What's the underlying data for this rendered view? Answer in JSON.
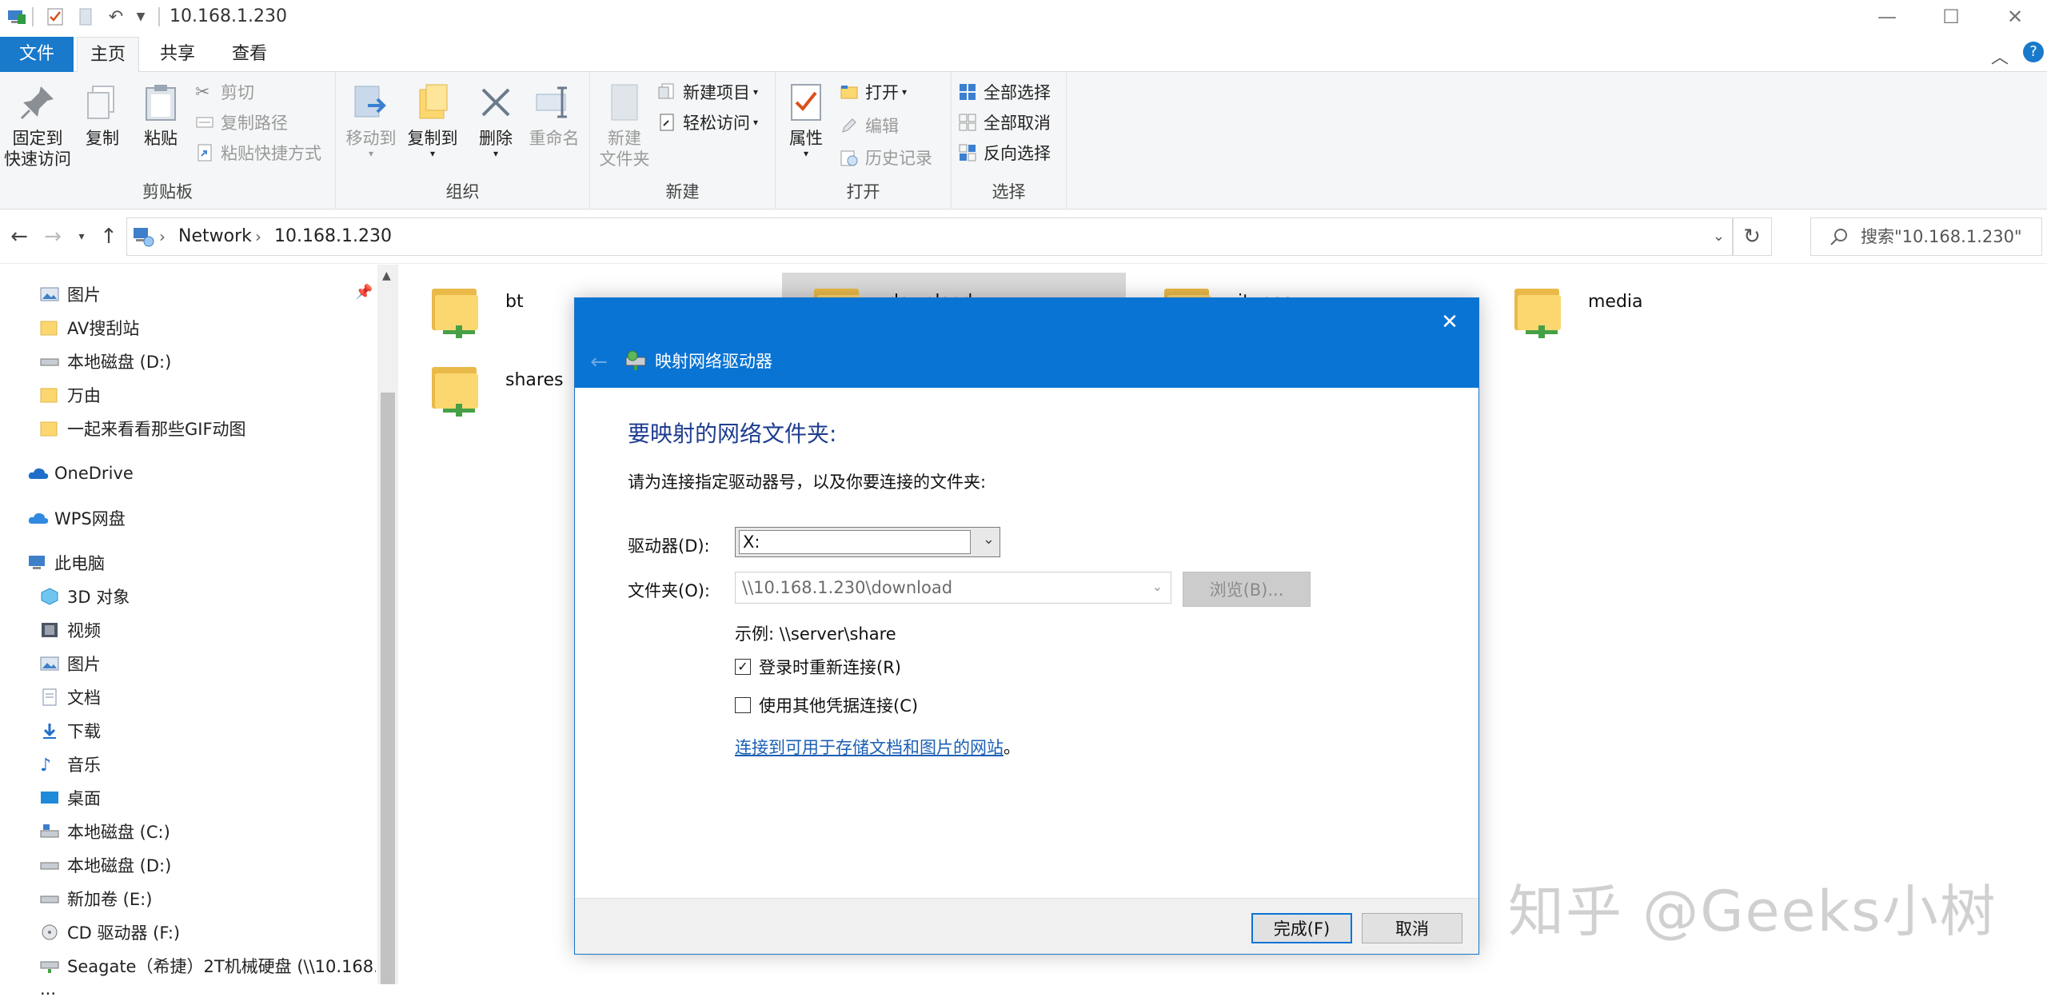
{
  "window": {
    "title": "10.168.1.230"
  },
  "ribbon_tabs": {
    "file": "文件",
    "home": "主页",
    "share": "共享",
    "view": "查看"
  },
  "ribbon": {
    "clipboard": {
      "label": "剪贴板",
      "pin_line1": "固定到",
      "pin_line2": "快速访问",
      "copy": "复制",
      "paste": "粘贴",
      "cut": "剪切",
      "copy_path": "复制路径",
      "paste_shortcut": "粘贴快捷方式"
    },
    "organize": {
      "label": "组织",
      "move_to": "移动到",
      "copy_to": "复制到",
      "delete": "删除",
      "rename": "重命名"
    },
    "new": {
      "label": "新建",
      "new_folder_line1": "新建",
      "new_folder_line2": "文件夹",
      "new_item": "新建项目",
      "easy_access": "轻松访问"
    },
    "open": {
      "label": "打开",
      "properties": "属性",
      "open": "打开",
      "edit": "编辑",
      "history": "历史记录"
    },
    "select": {
      "label": "选择",
      "select_all": "全部选择",
      "select_none": "全部取消",
      "invert": "反向选择"
    }
  },
  "address": {
    "crumbs": [
      "Network",
      "10.168.1.230"
    ],
    "search_placeholder": "搜索\"10.168.1.230\""
  },
  "nav": {
    "quick_items": [
      "图片",
      "AV搜刮站",
      "本地磁盘 (D:)",
      "万由",
      "一起来看看那些GIF动图"
    ],
    "onedrive": "OneDrive",
    "wps": "WPS网盘",
    "this_pc": "此电脑",
    "pc_items": [
      "3D 对象",
      "视频",
      "图片",
      "文档",
      "下载",
      "音乐",
      "桌面",
      "本地磁盘 (C:)",
      "本地磁盘 (D:)",
      "新加卷 (E:)",
      "CD 驱动器 (F:)",
      "Seagate（希捷）2T机械硬盘 (\\\\10.168.1.",
      "..."
    ]
  },
  "content": {
    "folders": [
      "bt",
      "download",
      "itunes",
      "media",
      "shares"
    ]
  },
  "dialog": {
    "title": "映射网络驱动器",
    "heading": "要映射的网络文件夹:",
    "instruction": "请为连接指定驱动器号，以及你要连接的文件夹:",
    "drive_label": "驱动器(D):",
    "drive_value": "X:",
    "folder_label": "文件夹(O):",
    "folder_value": "\\\\10.168.1.230\\download",
    "browse": "浏览(B)...",
    "example": "示例: \\\\server\\share",
    "reconnect": "登录时重新连接(R)",
    "reconnect_checked": true,
    "other_creds": "使用其他凭据连接(C)",
    "other_creds_checked": false,
    "link": "连接到可用于存储文档和图片的网站",
    "link_end": "。",
    "finish": "完成(F)",
    "cancel": "取消"
  },
  "watermark": "知乎 @Geeks小树",
  "colors": {
    "accent": "#1979ca",
    "dialog_header": "#0a74d4",
    "link": "#1a5fb4",
    "heading": "#1e3d8f"
  }
}
